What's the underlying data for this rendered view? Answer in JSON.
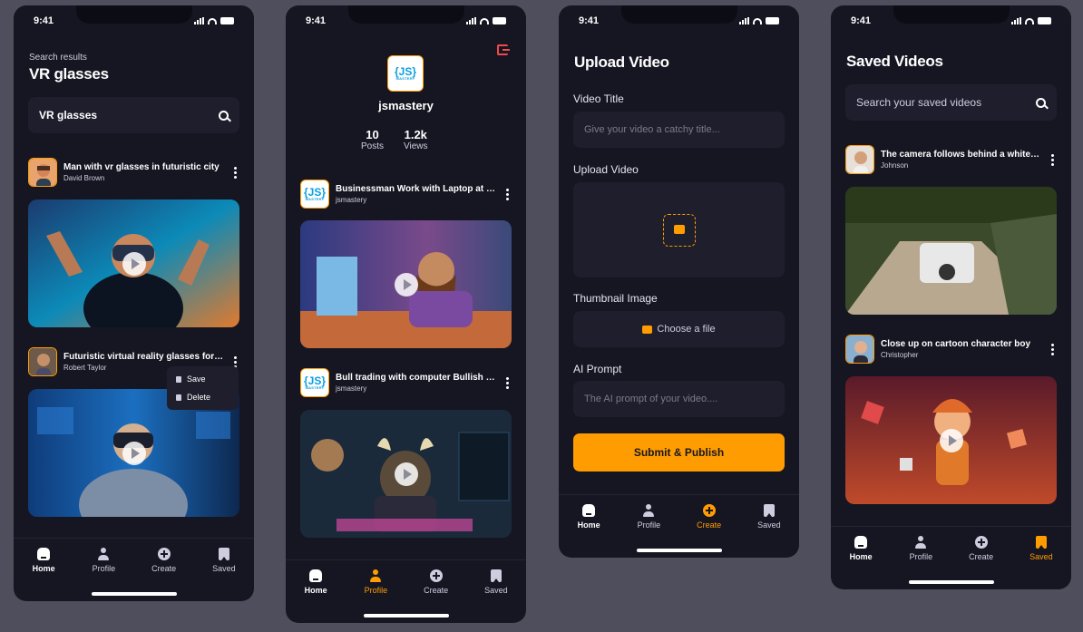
{
  "status": {
    "time": "9:41"
  },
  "screen1": {
    "subtitle": "Search results",
    "title": "VR glasses",
    "search_value": "VR glasses",
    "videos": [
      {
        "title": "Man with vr glasses in futuristic city",
        "author": "David Brown"
      },
      {
        "title": "Futuristic virtual reality glasses for gaming",
        "author": "Robert Taylor"
      }
    ],
    "menu": {
      "save": "Save",
      "delete": "Delete"
    }
  },
  "screen2": {
    "logo_text": "{JS}",
    "logo_sub": "MASTERY",
    "username": "jsmastery",
    "stats": [
      {
        "value": "10",
        "label": "Posts"
      },
      {
        "value": "1.2k",
        "label": "Views"
      }
    ],
    "videos": [
      {
        "title": "Businessman Work with Laptop at Night",
        "author": "jsmastery"
      },
      {
        "title": "Bull trading with computer Bullish market",
        "author": "jsmastery"
      }
    ]
  },
  "screen3": {
    "title": "Upload Video",
    "video_title_label": "Video Title",
    "video_title_placeholder": "Give your video a catchy title...",
    "upload_label": "Upload Video",
    "thumbnail_label": "Thumbnail Image",
    "choose_file": "Choose a file",
    "prompt_label": "AI Prompt",
    "prompt_placeholder": "The AI prompt of your video....",
    "submit": "Submit & Publish"
  },
  "screen4": {
    "title": "Saved Videos",
    "search_placeholder": "Search your saved videos",
    "videos": [
      {
        "title": "The camera follows behind a white vintage SUV",
        "author": "Johnson"
      },
      {
        "title": "Close up on cartoon character boy",
        "author": "Christopher"
      }
    ]
  },
  "tabs": {
    "home": "Home",
    "profile": "Profile",
    "create": "Create",
    "saved": "Saved"
  },
  "colors": {
    "accent": "#FF9C01",
    "background": "#161622",
    "surface": "#1E1E2D",
    "danger": "#F04A4A"
  }
}
